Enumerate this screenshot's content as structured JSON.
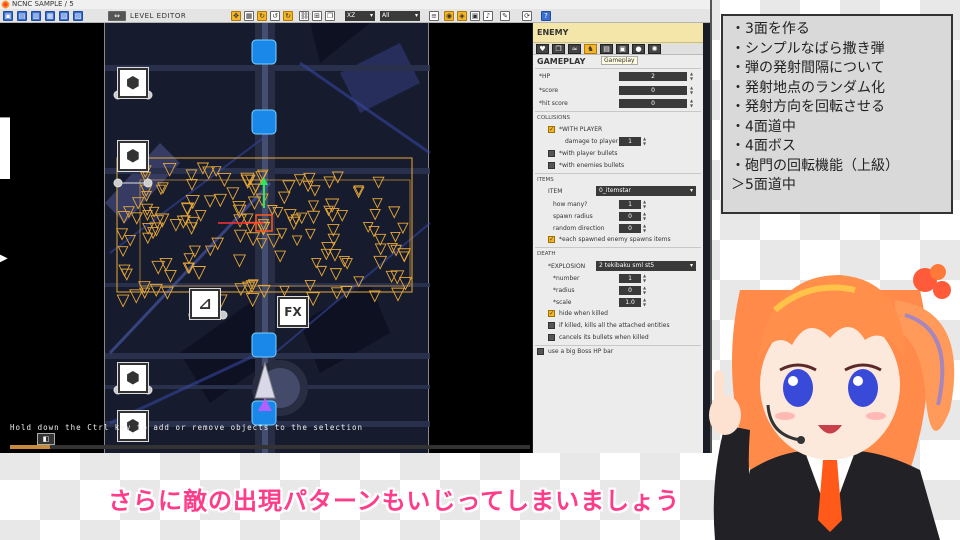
{
  "window": {
    "title": "NCNC SAMPLE / 5",
    "level_editor_label": "LEVEL EDITOR"
  },
  "toolbar": {
    "axis_select": "XZ",
    "filter_select": "All",
    "help_label": "?"
  },
  "viewport": {
    "hint": "Hold down the Ctrl key to add or remove objects to the selection",
    "fx_label": "FX"
  },
  "inspector": {
    "title": "ENEMY",
    "tab_tooltip": "Gameplay",
    "gameplay_header": "GAMEPLAY",
    "hp_label": "*HP",
    "hp_value": "2",
    "score_label": "*score",
    "score_value": "0",
    "hit_score_label": "*hit score",
    "hit_score_value": "0",
    "collisions": {
      "header": "COLLISIONS",
      "with_player_label": "*WITH PLAYER",
      "damage_label": "damage to player",
      "damage_value": "1",
      "with_player_bullets_label": "*with player bullets",
      "with_enemies_bullets_label": "*with enemies bullets"
    },
    "items": {
      "header": "ITEMS",
      "item_label": "ITEM",
      "item_value": "0_itemstar",
      "how_many_label": "how many?",
      "how_many_value": "1",
      "spawn_radius_label": "spawn radius",
      "spawn_radius_value": "0",
      "random_direction_label": "random direction",
      "random_direction_value": "0",
      "each_spawned_label": "*each spawned enemy spawns items"
    },
    "death": {
      "header": "DEATH",
      "explosion_label": "*EXPLOSION",
      "explosion_value": "2 tekibaku sml st5",
      "number_label": "*number",
      "number_value": "1",
      "radius_label": "*radius",
      "radius_value": "0",
      "scale_label": "*scale",
      "scale_value": "1.0",
      "hide_when_killed_label": "hide when killed",
      "if_killed_label": "if killed, kills all the attached entities",
      "cancels_bullets_label": "cancels its bullets when killed"
    },
    "boss_hp_bar_label": "use a big Boss HP bar"
  },
  "notes": [
    "・3面を作る",
    "・シンプルなばら撒き弾",
    "・弾の発射間隔について",
    "・発射地点のランダム化",
    "・発射方向を回転させる",
    "・4面道中",
    "・4面ボス",
    "・砲門の回転機能（上級）",
    "＞5面道中"
  ],
  "subtitle": "さらに敵の出現パターンもいじってしまいましょう",
  "colors": {
    "accent_orange": "#f5b529",
    "subtitle_pink": "#ff3c8a",
    "marker_orange": "#e8a838",
    "turret_blue": "#2aa8ff"
  }
}
